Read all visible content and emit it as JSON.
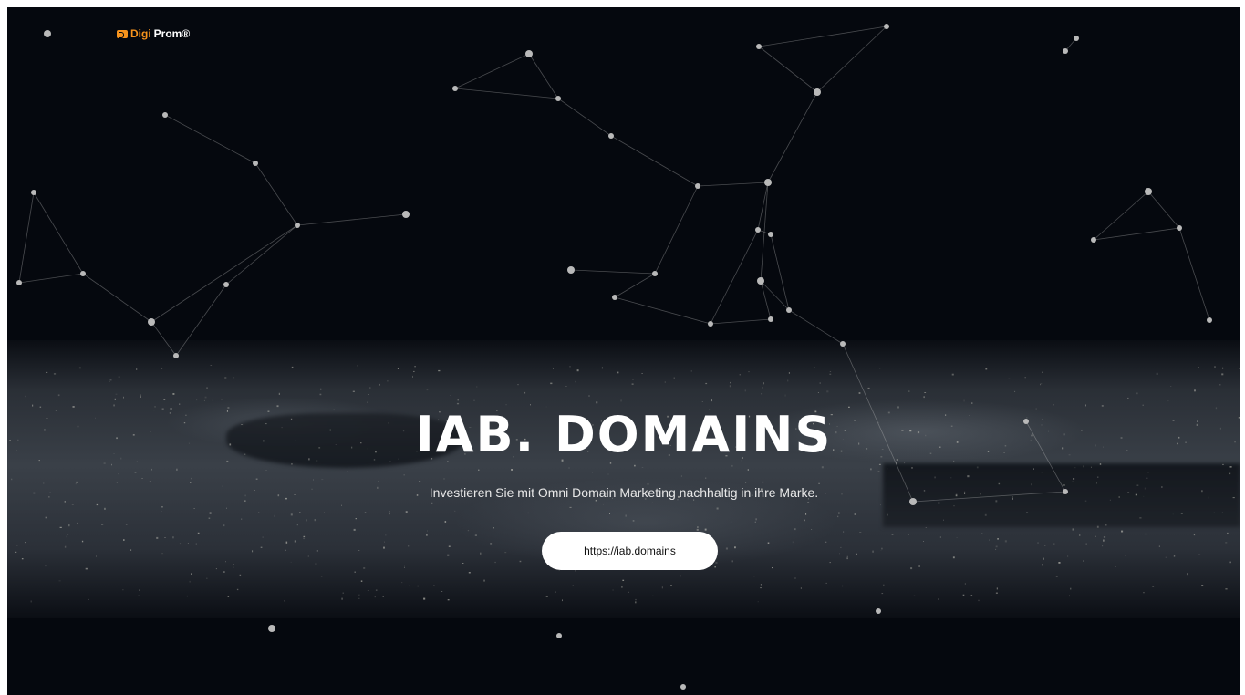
{
  "brand": {
    "name_part1": "Digi",
    "name_part2": "Prom®",
    "accent_color": "#f7941d"
  },
  "hero": {
    "title": "IAB. DOMAINS",
    "subtitle": "Investieren Sie mit Omni Domain Marketing nachhaltig in ihre Marke.",
    "button_label": "https://iab.domains"
  },
  "colors": {
    "background": "#05080e",
    "text": "#ffffff"
  }
}
